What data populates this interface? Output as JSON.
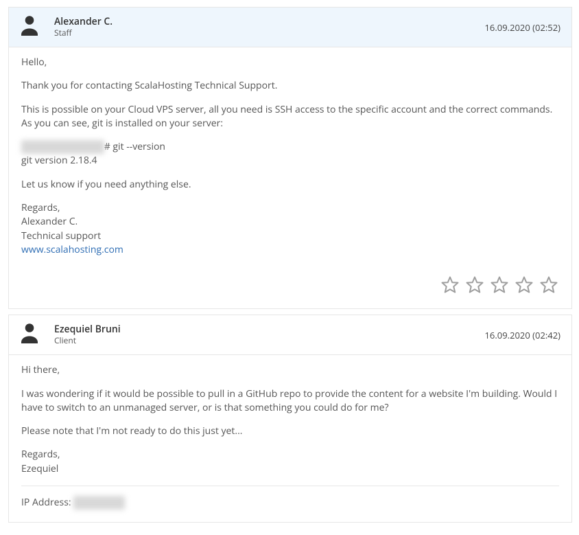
{
  "messages": [
    {
      "name": "Alexander C.",
      "role": "Staff",
      "timestamp": "16.09.2020 (02:52)",
      "greeting": "Hello,",
      "lines": {
        "thanks": "Thank you for contacting ScalaHosting Technical Support.",
        "possible": "This is possible on your Cloud VPS server, all you need is SSH access to the specific account and the correct commands. As you can see, git is installed on your server:",
        "prompt_redacted": "[root@cloud ~~~~]",
        "prompt_cmd": "# git --version",
        "git_version": "git version 2.18.4",
        "closing": "Let us know if you need anything else.",
        "regards": "Regards,",
        "sig_name": "Alexander C.",
        "sig_title": "Technical support",
        "sig_link": "www.scalahosting.com"
      }
    },
    {
      "name": "Ezequiel Bruni",
      "role": "Client",
      "timestamp": "16.09.2020 (02:42)",
      "greeting": "Hi there,",
      "lines": {
        "q": "I was wondering if it would be possible to pull in a GitHub repo to provide the content for a website I'm building. Would I have to switch to an unmanaged server, or is that something you could do for me?",
        "note": "Please note that I'm not ready to do this just yet...",
        "regards": "Regards,",
        "sig_name": "Ezequiel",
        "ip_label": "IP Address: ",
        "ip_redacted": "00.0.000.00"
      }
    }
  ]
}
